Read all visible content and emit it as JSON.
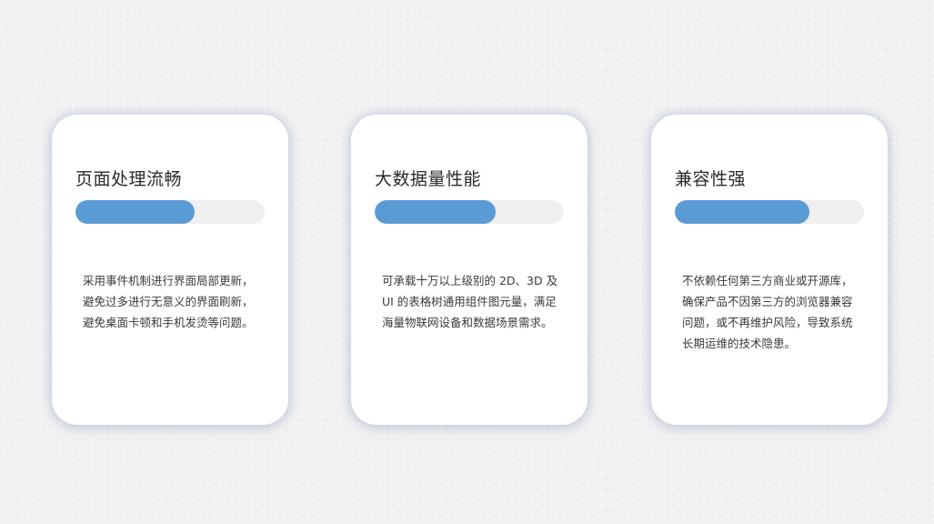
{
  "cards": [
    {
      "title": "页面处理流畅",
      "progress": 0.63,
      "description": "采用事件机制进行界面局部更新，\n避免过多进行无意义的界面刷新，\n避免桌面卡顿和手机发烫等问题。"
    },
    {
      "title": "大数据量性能",
      "progress": 0.64,
      "description": "可承载十万以上级别的 2D、3D 及\nUI 的表格树通用组件图元量，满足\n海量物联网设备和数据场景需求。"
    },
    {
      "title": "兼容性强",
      "progress": 0.71,
      "description": "不依赖任何第三方商业或开源库，\n确保产品不因第三方的浏览器兼容\n问题，或不再维护风险，导致系统\n长期运维的技术隐患。"
    }
  ],
  "colors": {
    "accent": "#5b9bd5",
    "track": "#efefef",
    "card_background": "#ffffff",
    "page_background": "#f1f1f1"
  }
}
